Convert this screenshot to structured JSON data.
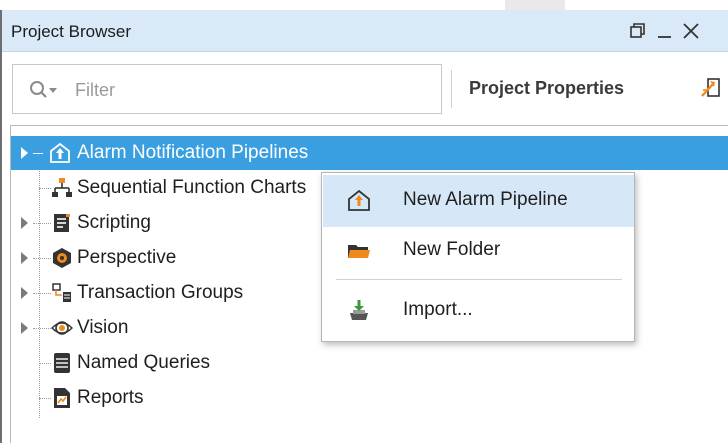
{
  "panel": {
    "title": "Project Browser",
    "window_buttons": [
      "restore-icon",
      "minimize-icon",
      "close-icon"
    ]
  },
  "toolbar": {
    "filter_placeholder": "Filter",
    "filter_value": "",
    "project_properties_label": "Project Properties"
  },
  "tree": {
    "items": [
      {
        "label": "Alarm Notification Pipelines",
        "icon": "alarm-pipeline-icon",
        "expandable": true,
        "selected": true
      },
      {
        "label": "Sequential Function Charts",
        "icon": "sfc-icon",
        "expandable": false
      },
      {
        "label": "Scripting",
        "icon": "script-icon",
        "expandable": true
      },
      {
        "label": "Perspective",
        "icon": "perspective-icon",
        "expandable": true
      },
      {
        "label": "Transaction Groups",
        "icon": "transaction-groups-icon",
        "expandable": true
      },
      {
        "label": "Vision",
        "icon": "vision-icon",
        "expandable": true
      },
      {
        "label": "Named Queries",
        "icon": "named-queries-icon",
        "expandable": false
      },
      {
        "label": "Reports",
        "icon": "reports-icon",
        "expandable": false
      }
    ]
  },
  "context_menu": {
    "items": [
      {
        "label": "New Alarm Pipeline",
        "icon": "alarm-pipeline-icon",
        "highlighted": true
      },
      {
        "label": "New Folder",
        "icon": "folder-icon"
      },
      {
        "label": "Import...",
        "icon": "import-icon"
      }
    ]
  },
  "colors": {
    "titlebar": "#d9e9f7",
    "selection": "#3a9fe0",
    "menu_highlight": "#d6e8f8",
    "accent_orange": "#f08a1c"
  }
}
